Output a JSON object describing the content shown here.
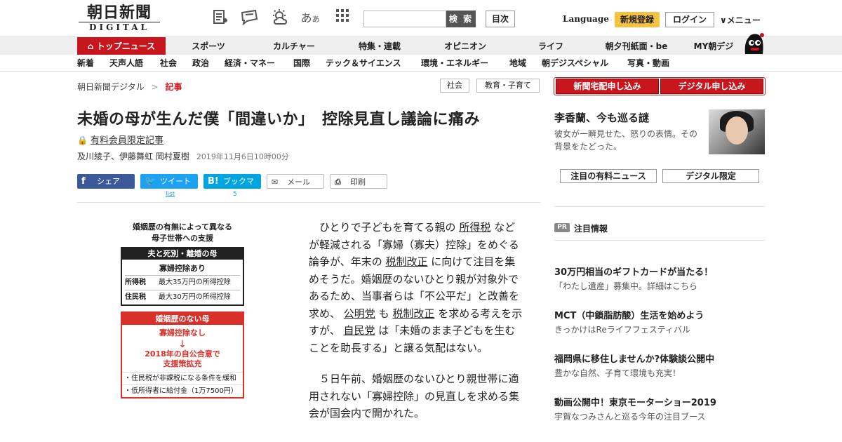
{
  "header": {
    "logo_jp": "朝日新聞",
    "logo_en": "DIGITAL",
    "search": {
      "placeholder": "",
      "button": "検 索"
    },
    "toc_button": "目次",
    "language": "Language",
    "signup": "新規登録",
    "login": "ログイン",
    "menu": "メニュー"
  },
  "nav_primary": [
    {
      "label": "トップニュース",
      "active": true
    },
    {
      "label": "スポーツ"
    },
    {
      "label": "カルチャー"
    },
    {
      "label": "特集・連載"
    },
    {
      "label": "オピニオン"
    },
    {
      "label": "ライフ"
    },
    {
      "label": "朝夕刊紙面・be"
    },
    {
      "label": "MY朝デジ"
    }
  ],
  "nav_secondary": [
    "新着",
    "天声人語",
    "社会",
    "政治",
    "経済・マネー",
    "国際",
    "テック＆サイエンス",
    "環境・エネルギー",
    "地域",
    "朝デジスペシャル",
    "写真・動画"
  ],
  "breadcrumb": {
    "root": "朝日新聞デジタル",
    "sep": ">",
    "current": "記事"
  },
  "tags": [
    "社会",
    "教育・子育て"
  ],
  "article": {
    "title": "未婚の母が生んだ僕「間違いか」　控除見直し議論に痛み",
    "members_label": "有料会員限定記事",
    "authors": "及川綾子、伊藤舞虹 岡村夏樹",
    "date": "2019年11月6日10時00分",
    "paragraph1": {
      "s1": "ひとりで子どもを育てる親の",
      "k1": "所得税",
      "s2": "などが軽減される「寡婦（寡夫）控除」をめぐる論争が、年末の",
      "k2": "税制改正",
      "s3": "に向けて注目を集めそうだ。婚姻歴のないひとり親が対象外であるため、当事者らは「不公平だ」と改善を求め、",
      "k3": "公明党",
      "s4": "も",
      "k4": "税制改正",
      "s5": "を求める考えを示すが、",
      "k5": "自民党",
      "s6": "は「未婚のまま子どもを生むことを助長する」と譲る気配はない。"
    },
    "paragraph2": "５日午前、婚姻歴のないひとり親世帯に適用されない「寡婦控除」の見直しを求める集会が国会内で開かれた。"
  },
  "share": {
    "facebook": "シェア",
    "twitter": "ツイート",
    "twitter_count": "list",
    "hatena": "ブックマーク",
    "hatena_count": "5",
    "mail": "メール",
    "print": "印刷"
  },
  "figure": {
    "title_l1": "婚姻歴の有無によって異なる",
    "title_l2": "母子世帯への支援",
    "box1": {
      "header": "夫と死別・離婚の母",
      "sub": "寡婦控除あり",
      "rows": [
        {
          "k": "所得税",
          "v": "最大35万円の所得控除"
        },
        {
          "k": "住民税",
          "v": "最大30万円の所得控除"
        }
      ]
    },
    "box2": {
      "header": "婚姻歴のない母",
      "sub": "寡婦控除なし",
      "arrow": "↓",
      "red_l1": "2018年の自公合意で",
      "red_l2": "支援策拡充",
      "items": [
        "・住民税が非課税になる条件を緩和",
        "・低所得者に給付金（1万7500円）"
      ]
    }
  },
  "sidebar": {
    "cta1": "新聞宅配申し込み",
    "cta2": "デジタル申し込み",
    "feature_title": "李香蘭、今も巡る謎",
    "feature_desc": "彼女が一瞬見せた、怒りの表情。その背景をたどった。",
    "btn_news": "注目の有料ニュース",
    "btn_digital": "デジタル限定",
    "pr_badge": "PR",
    "pr_label": "注目情報",
    "pr_items": [
      {
        "h": "30万円相当のギフトカードが当たる！",
        "d": "「わたし遺産」募集中。詳細はこちら"
      },
      {
        "h": "MCT（中鎖脂肪酸）生活を始めよう",
        "d": "きっかけはReライフフェスティバル"
      },
      {
        "h": "福岡県に移住しませんか?体験談公開中",
        "d": "豊かな自然、子育て環境も充実！"
      },
      {
        "h": "動画公開中！東京モーターショー2019",
        "d": "宇賀なつみさんと巡る今年の注目ブース"
      }
    ]
  },
  "colors": {
    "brand_red": "#c8161d",
    "signup_yellow": "#f5c242",
    "facebook": "#3b5998",
    "twitter": "#1da1f2",
    "hatena": "#00a4de"
  }
}
